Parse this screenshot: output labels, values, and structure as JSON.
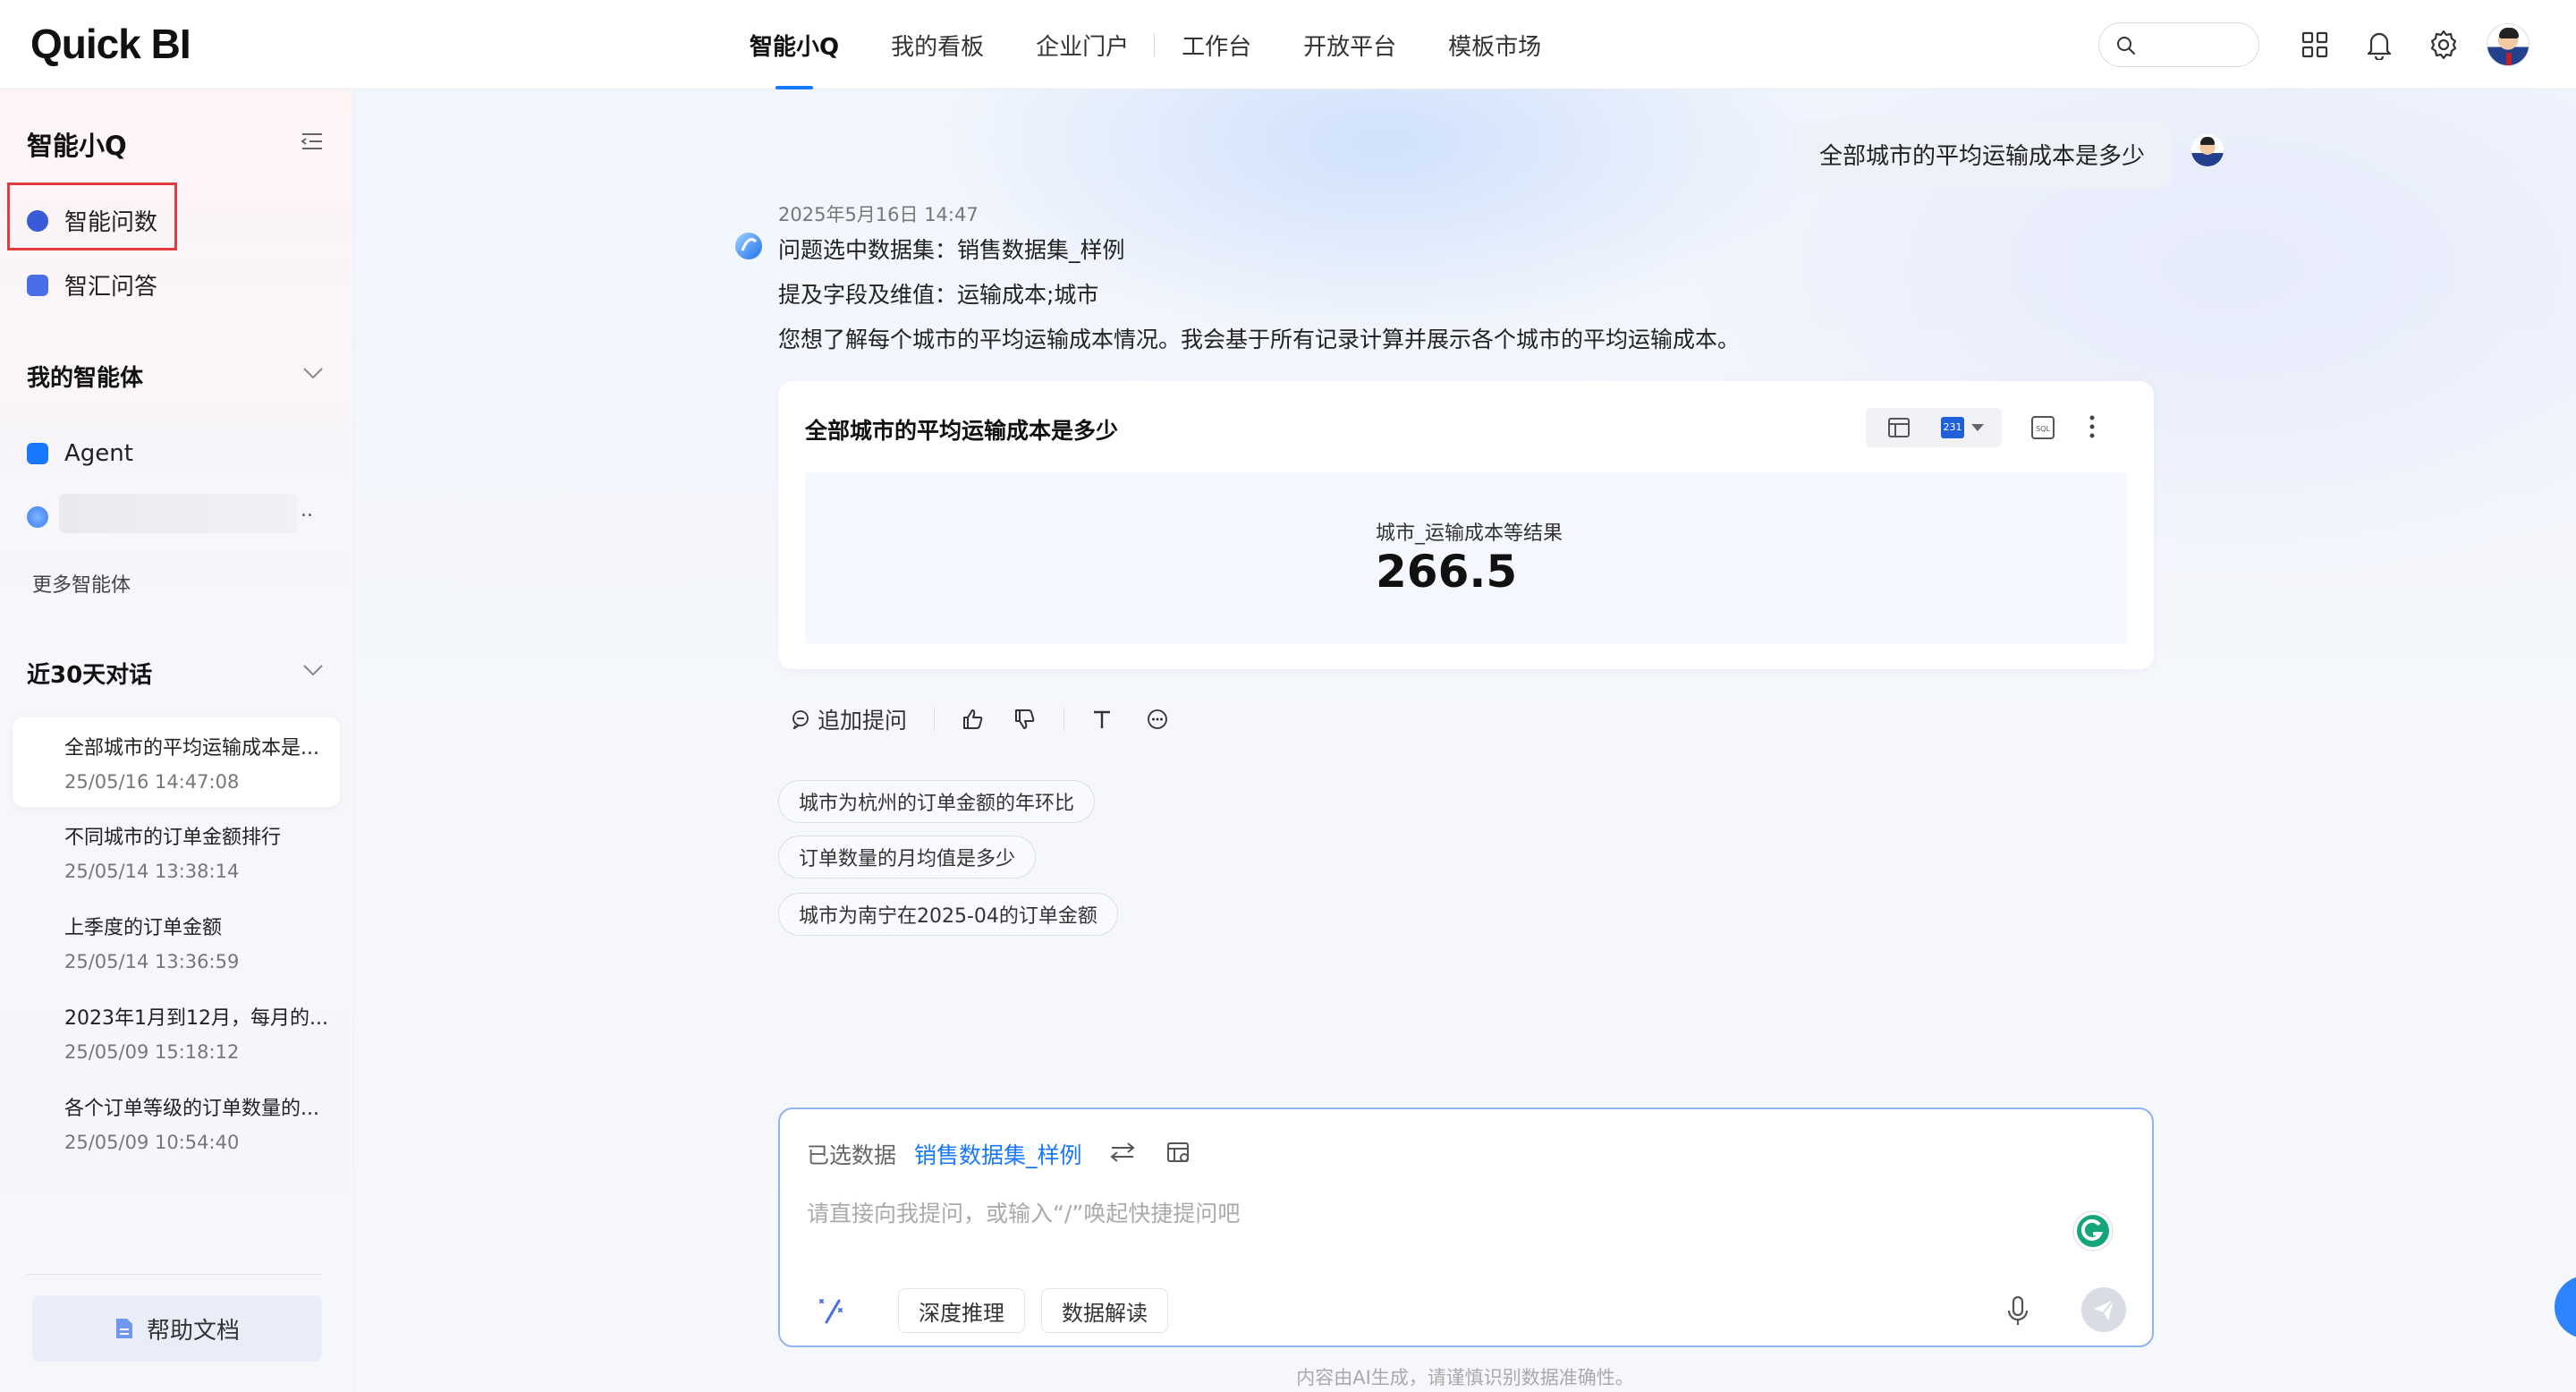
{
  "app": {
    "logo": "Quick BI",
    "nav": [
      "智能小Q",
      "我的看板",
      "企业门户",
      "工作台",
      "开放平台",
      "模板市场"
    ],
    "active_nav": "智能小Q",
    "search_placeholder": ""
  },
  "sidebar": {
    "title": "智能小Q",
    "items": [
      {
        "label": "智能问数",
        "icon": "smart-query-icon",
        "highlighted": true
      },
      {
        "label": "智汇问答",
        "icon": "chat-qa-icon"
      }
    ],
    "my_agents": {
      "title": "我的智能体",
      "items": [
        {
          "label": "Agent",
          "icon": "agent-icon"
        },
        {
          "label": "..",
          "icon": "agent-blue-icon"
        }
      ],
      "more": "更多智能体"
    },
    "recent": {
      "title": "近30天对话",
      "conversations": [
        {
          "title": "全部城市的平均运输成本是...",
          "time": "25/05/16 14:47:08",
          "active": true
        },
        {
          "title": "不同城市的订单金额排行",
          "time": "25/05/14 13:38:14"
        },
        {
          "title": "上季度的订单金额",
          "time": "25/05/14 13:36:59"
        },
        {
          "title": "2023年1月到12月，每月的...",
          "time": "25/05/09 15:18:12"
        },
        {
          "title": "各个订单等级的订单数量的...",
          "time": "25/05/09 10:54:40"
        }
      ]
    },
    "help": "帮助文档"
  },
  "chat": {
    "user_question": "全部城市的平均运输成本是多少",
    "timestamp": "2025年5月16日 14:47",
    "answer_lines": [
      "问题选中数据集：销售数据集_样例",
      "提及字段及维值：运输成本;城市",
      "您想了解每个城市的平均运输成本情况。我会基于所有记录计算并展示各个城市的平均运输成本。"
    ],
    "card": {
      "title": "全部城市的平均运输成本是多少",
      "kpi_label": "城市_运输成本等结果",
      "kpi_value": "266.5",
      "calendar_badge": "231"
    },
    "actions": {
      "follow_up": "追加提问"
    },
    "suggestions": [
      "城市为杭州的订单金额的年环比",
      "订单数量的月均值是多少",
      "城市为南宁在2025-04的订单金额"
    ]
  },
  "composer": {
    "selected_label": "已选数据",
    "dataset": "销售数据集_样例",
    "placeholder": "请直接向我提问，或输入“/”唤起快捷提问吧",
    "chips": [
      "深度推理",
      "数据解读"
    ],
    "footnote": "内容由AI生成，请谨慎识别数据准确性。"
  },
  "colors": {
    "accent": "#1677ff",
    "highlight_border": "#e23c3c"
  }
}
